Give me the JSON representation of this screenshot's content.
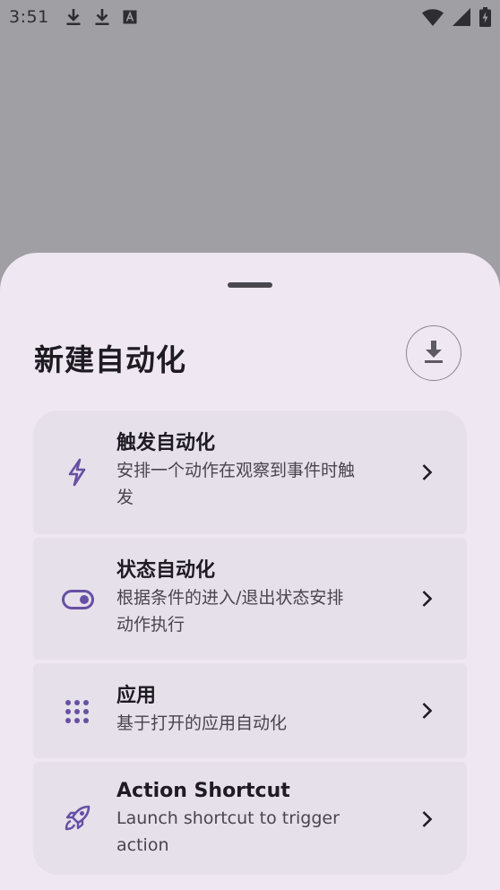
{
  "status_bar": {
    "time": "3:51",
    "left_icons": [
      "download-icon",
      "download-icon",
      "keyboard-a-icon"
    ],
    "right_icons": [
      "wifi-icon",
      "signal-icon",
      "battery-charging-icon"
    ]
  },
  "sheet": {
    "title": "新建自动化",
    "download_button_icon": "download-icon"
  },
  "options": [
    {
      "icon": "bolt-icon",
      "title": "触发自动化",
      "subtitle_line1": "安排一个动作在观察到事件时触",
      "subtitle_line2": "发"
    },
    {
      "icon": "toggle-icon",
      "title": "状态自动化",
      "subtitle_line1": "根据条件的进入/退出状态安排",
      "subtitle_line2": "动作执行"
    },
    {
      "icon": "apps-grid-icon",
      "title": "应用",
      "subtitle_line1": "基于打开的应用自动化",
      "subtitle_line2": ""
    },
    {
      "icon": "rocket-icon",
      "title": "Action Shortcut",
      "subtitle_line1": "Launch shortcut to trigger",
      "subtitle_line2": "action"
    }
  ],
  "colors": {
    "scrim": "#a09fa4",
    "sheet_bg": "#efe8f3",
    "card_bg": "#e6e0ea",
    "accent_icon": "#6750a4",
    "title_text": "#1e1b22",
    "subtitle_text": "#49454f"
  }
}
